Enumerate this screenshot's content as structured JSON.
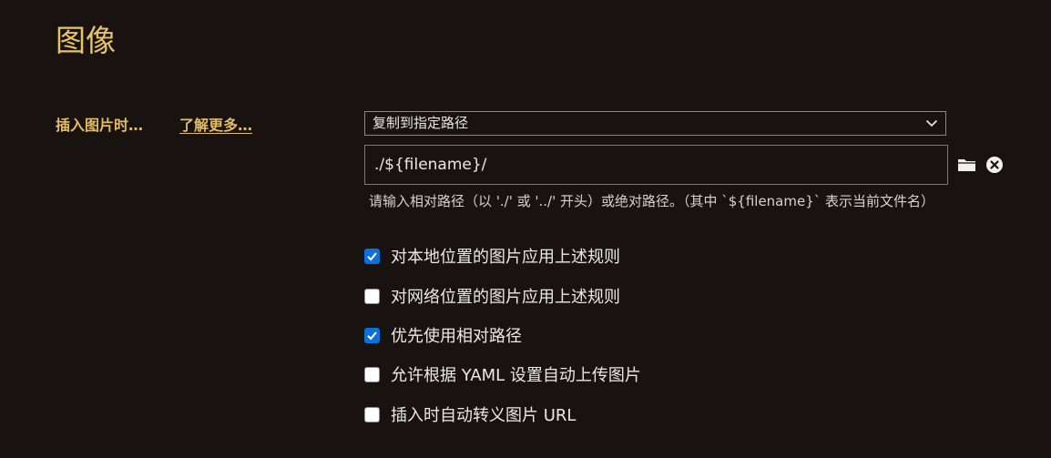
{
  "title": "图像",
  "insert_image": {
    "label": "插入图片时…",
    "learn_more": "了解更多…",
    "action_selected": "复制到指定路径",
    "path_value": "./${filename}/",
    "hint": "请输入相对路径（以 './' 或 '../' 开头）或绝对路径。（其中 `${filename}` 表示当前文件名）"
  },
  "options": [
    {
      "label": "对本地位置的图片应用上述规则",
      "checked": true
    },
    {
      "label": "对网络位置的图片应用上述规则",
      "checked": false
    },
    {
      "label": "优先使用相对路径",
      "checked": true
    },
    {
      "label": "允许根据 YAML 设置自动上传图片",
      "checked": false
    },
    {
      "label": "插入时自动转义图片 URL",
      "checked": false
    }
  ],
  "colors": {
    "background": "#181311",
    "heading": "#e8c466",
    "label": "#e2bc5e",
    "checkbox_checked": "#0b70d8"
  },
  "icons": {
    "select_arrow": "chevron-down-icon",
    "browse": "folder-icon",
    "clear": "clear-circle-icon"
  }
}
